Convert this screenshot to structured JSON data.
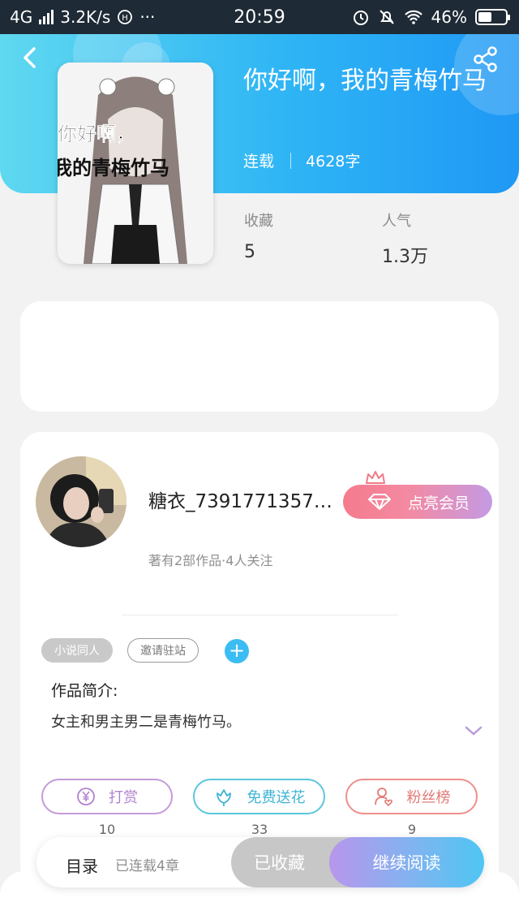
{
  "status_bar": {
    "network": "4G",
    "speed": "3.2K/s",
    "extra_icon": "hd-icon",
    "dots": "···",
    "time": "20:59",
    "battery": "46%",
    "battery_level": 0.46
  },
  "header": {
    "book_title": "你好啊，我的青梅竹马",
    "status": "连载",
    "word_count": "4628字",
    "cover_text_line1": "你好啊，",
    "cover_text_line2": "我的青梅竹马"
  },
  "stats": {
    "favorites_label": "收藏",
    "favorites_value": "5",
    "popularity_label": "人气",
    "popularity_value": "1.3万"
  },
  "author": {
    "name": "糖衣_7391771357…",
    "works": "著有2部作品·4人关注",
    "vip_button": "点亮会员"
  },
  "tags": [
    "小说同人",
    "邀请驻站"
  ],
  "add_tag": "+",
  "intro": {
    "label": "作品简介:",
    "text": "女主和男主男二是青梅竹马。"
  },
  "actions": [
    {
      "label": "打赏",
      "count": "10",
      "icon": "yen-icon"
    },
    {
      "label": "免费送花",
      "count": "33",
      "icon": "flower-icon"
    },
    {
      "label": "粉丝榜",
      "count": "9",
      "icon": "fan-user-icon"
    }
  ],
  "bottom_bar": {
    "toc": "目录",
    "chapters": "已连载4章",
    "collected": "已收藏",
    "continue": "继续阅读"
  },
  "colors": {
    "header_start": "#5fd8f0",
    "header_end": "#1f98f5",
    "accent_blue": "#3bbdf3",
    "vip_pink": "#f57b8c",
    "vip_purple": "#c49ae4"
  }
}
